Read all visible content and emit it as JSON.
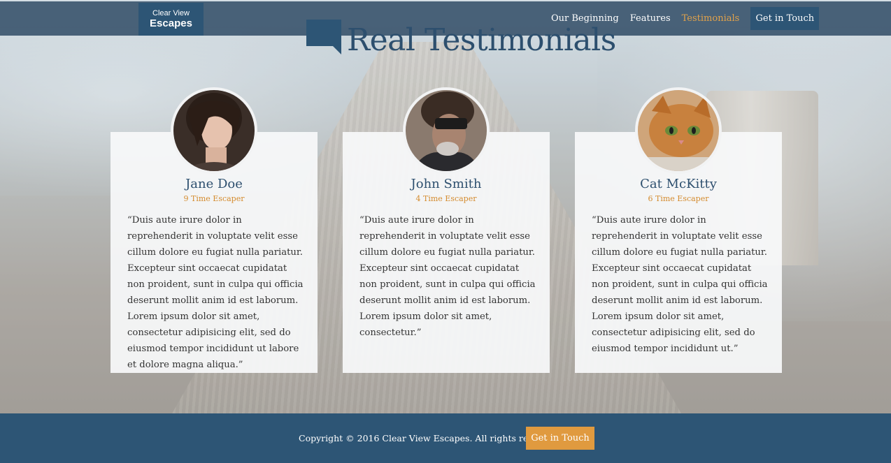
{
  "brand": {
    "line1": "Clear View",
    "line2": "Escapes"
  },
  "nav": {
    "items": [
      {
        "label": "Our Beginning",
        "active": false
      },
      {
        "label": "Features",
        "active": false
      },
      {
        "label": "Testimonials",
        "active": true
      }
    ],
    "cta": "Get in Touch"
  },
  "section": {
    "title": "Real Testimonials"
  },
  "testimonials": [
    {
      "name": "Jane Doe",
      "subtitle": "9 Time Escaper",
      "quote": "“Duis aute irure dolor in reprehenderit in voluptate velit esse cillum dolore eu fugiat nulla pariatur. Excepteur sint occaecat cupidatat non proident, sunt in culpa qui officia deserunt mollit anim id est laborum. Lorem ipsum dolor sit amet, consectetur adipisicing elit, sed do eiusmod tempor incididunt ut labore et dolore magna aliqua.”"
    },
    {
      "name": "John Smith",
      "subtitle": "4 Time Escaper",
      "quote": "“Duis aute irure dolor in reprehenderit in voluptate velit esse cillum dolore eu fugiat nulla pariatur. Excepteur sint occaecat cupidatat non proident, sunt in culpa qui officia deserunt mollit anim id est laborum. Lorem ipsum dolor sit amet, consectetur.”"
    },
    {
      "name": "Cat McKitty",
      "subtitle": "6 Time Escaper",
      "quote": "“Duis aute irure dolor in reprehenderit in voluptate velit esse cillum dolore eu fugiat nulla pariatur. Excepteur sint occaecat cupidatat non proident, sunt in culpa qui officia deserunt mollit anim id est laborum. Lorem ipsum dolor sit amet, consectetur adipisicing elit, sed do eiusmod tempor incididunt ut.”"
    }
  ],
  "footer": {
    "copyright": "Copyright © 2016 Clear View Escapes. All rights reserved.",
    "cta": "Get in Touch"
  },
  "colors": {
    "primary": "#2d5575",
    "accent": "#e09a3f",
    "title": "#2d4f6e"
  },
  "icons": {
    "title": "speech-bubble-icon"
  }
}
